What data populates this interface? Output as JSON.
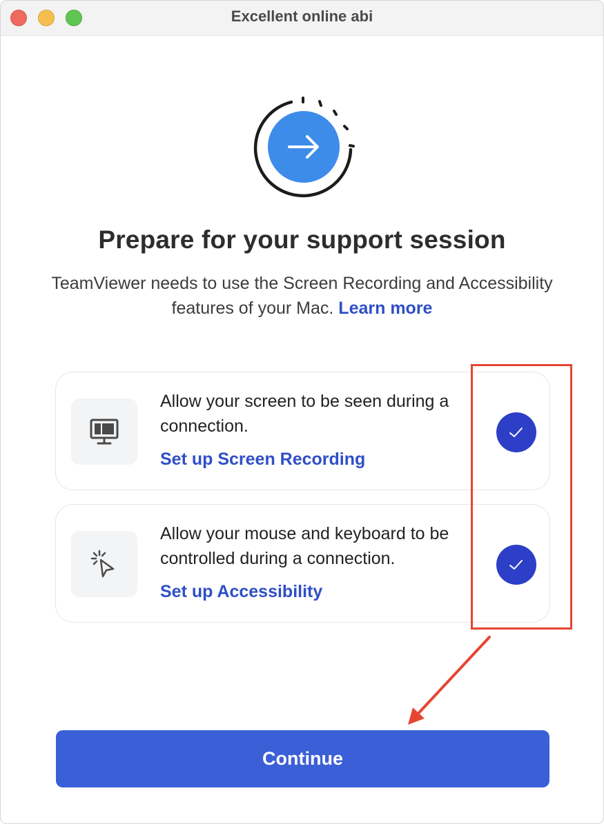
{
  "window": {
    "title": "Excellent online abi"
  },
  "hero": {
    "icon": "arrow-right-icon",
    "accent_color": "#3d8cea"
  },
  "headline": "Prepare for your support session",
  "intro": {
    "text": "TeamViewer needs to use the Screen Recording and Accessibility features of your Mac.",
    "link_label": "Learn more"
  },
  "permissions": [
    {
      "icon": "monitor-icon",
      "description": "Allow your screen to be seen during a connection.",
      "link_label": "Set up Screen Recording",
      "status": "granted"
    },
    {
      "icon": "cursor-click-icon",
      "description": "Allow your mouse and keyboard to be controlled during a connection.",
      "link_label": "Set up Accessibility",
      "status": "granted"
    }
  ],
  "continue_button": {
    "label": "Continue",
    "color": "#3b5fd6"
  },
  "annotation": {
    "color": "#e64532"
  }
}
